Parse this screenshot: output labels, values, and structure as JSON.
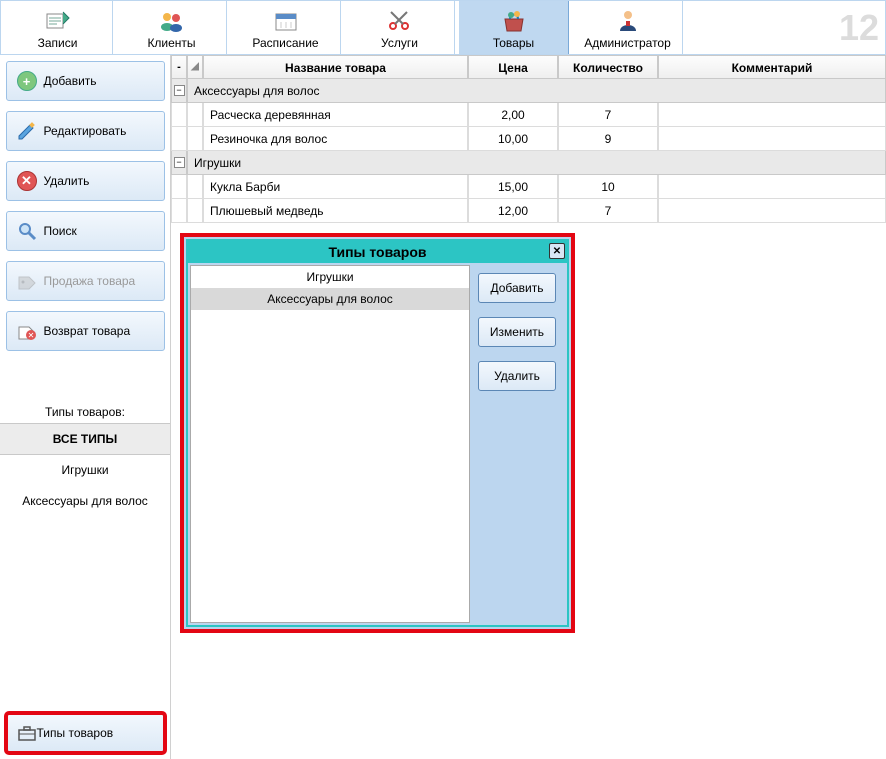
{
  "toolbar": {
    "zapisi": "Записи",
    "klienty": "Клиенты",
    "raspisanie": "Расписание",
    "uslugi": "Услуги",
    "tovary": "Товары",
    "administrator": "Администратор",
    "big_number": "12"
  },
  "sidebar": {
    "add_label": "Добавить",
    "edit_label": "Редактировать",
    "delete_label": "Удалить",
    "search_label": "Поиск",
    "sale_label": "Продажа товара",
    "return_label": "Возврат товара",
    "types_header": "Типы товаров:",
    "all_types": "ВСЕ ТИПЫ",
    "type1": "Игрушки",
    "type2": "Аксессуары для волос",
    "bottom_types_label": "Типы товаров"
  },
  "grid": {
    "col_name": "Название товара",
    "col_price": "Цена",
    "col_qty": "Количество",
    "col_comment": "Комментарий",
    "group1": "Аксессуары для волос",
    "r1_name": "Расческа деревянная",
    "r1_price": "2,00",
    "r1_qty": "7",
    "r2_name": "Резиночка для волос",
    "r2_price": "10,00",
    "r2_qty": "9",
    "group2": "Игрушки",
    "r3_name": "Кукла Барби",
    "r3_price": "15,00",
    "r3_qty": "10",
    "r4_name": "Плюшевый медведь",
    "r4_price": "12,00",
    "r4_qty": "7"
  },
  "modal": {
    "title": "Типы товаров",
    "item1": "Игрушки",
    "item2": "Аксессуары для волос",
    "add": "Добавить",
    "edit": "Изменить",
    "delete": "Удалить"
  }
}
